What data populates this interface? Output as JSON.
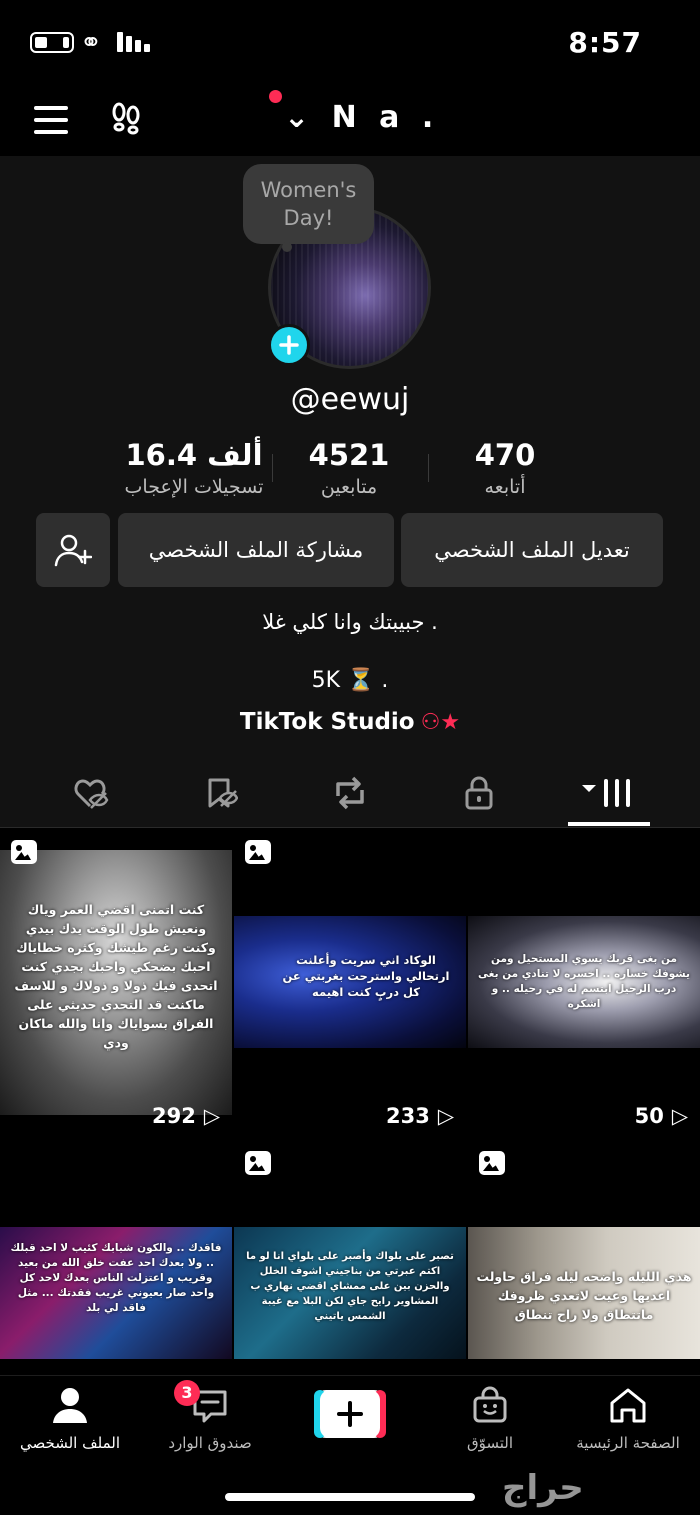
{
  "status_bar": {
    "time": "8:57"
  },
  "top_nav": {
    "account_name": "N a ."
  },
  "profile": {
    "note": "Women's Day!",
    "username": "@eewuj",
    "stats": [
      {
        "value": "470",
        "label": "أتابعه"
      },
      {
        "value": "4521",
        "label": "متابعين"
      },
      {
        "value": "16.4 ألف",
        "label": "تسجيلات الإعجاب"
      }
    ],
    "edit_button": "تعديل الملف الشخصي",
    "share_button": "مشاركة الملف الشخصي",
    "bio": "جبيبتك وانا كلي غلا .",
    "link_line": "5K ⏳ .",
    "studio": "TikTok Studio"
  },
  "tabs": [
    "videos",
    "private",
    "reposts",
    "favorites",
    "liked"
  ],
  "videos": [
    {
      "views": "292",
      "text": "كنت اتمنى اقضي العمر وياك ونعيش طول الوقت يدك بيدي وكنت رغم طيشك وكثره خطاياك احبك بضحكي واحبك بجدي كنت اتحدى فيك ذولا و ذولاك و للاسف ماكنت قد التحدي حديثي على الفراق بسواياك وانا والله ماكان ودي"
    },
    {
      "views": "233",
      "text": "الوكاد اني سريت وأعلنت ارتحالي واسترحت بغربتي عن كل دربٍ كنت اهيمه"
    },
    {
      "views": "50",
      "text": "من بغى قربك يسوي المستحيل ومن يشوفك خساره .. اخسره لا تنادي من بغى درب الرحيل ابتسم له في رحيله .. و اشكره"
    },
    {
      "views": "",
      "text": "فاقدك .. والكون شبابك كئيب لا احد قبلك .. ولا بعدك احد عفت خلق الله من بعيد وقريب و اعتزلت الناس بعدك لاحد كل واحد صار بعيوني غريب فقدتك ... مثل فاقد لي بلد"
    },
    {
      "views": "",
      "text": "تصبر على بلواك وأصبر على بلواي انا لو ما اكتم عبرتي من بناجيني اشوف الخلل والحزن بين على ممشاي اقضي نهاري ب المشاوير رايح جاي لكن البلا مع غيبة الشمس ياتيني"
    },
    {
      "views": "",
      "text": "هذي الليله واضحه ليله فراق حاولت اعديها وعيت لاتعدي ظروفك ماتتطاق ولا راح تنطاق"
    }
  ],
  "bottom_nav": {
    "home": "الصفحة الرئيسية",
    "shop": "التسوّق",
    "inbox": "صندوق الوارد",
    "inbox_badge": "3",
    "profile": "الملف الشخصي"
  },
  "watermark": "حراج",
  "colors": {
    "accent": "#fe2c55",
    "cyan": "#20d5ec",
    "button_bg": "#2f2f2f",
    "profile_bg": "#121212"
  }
}
